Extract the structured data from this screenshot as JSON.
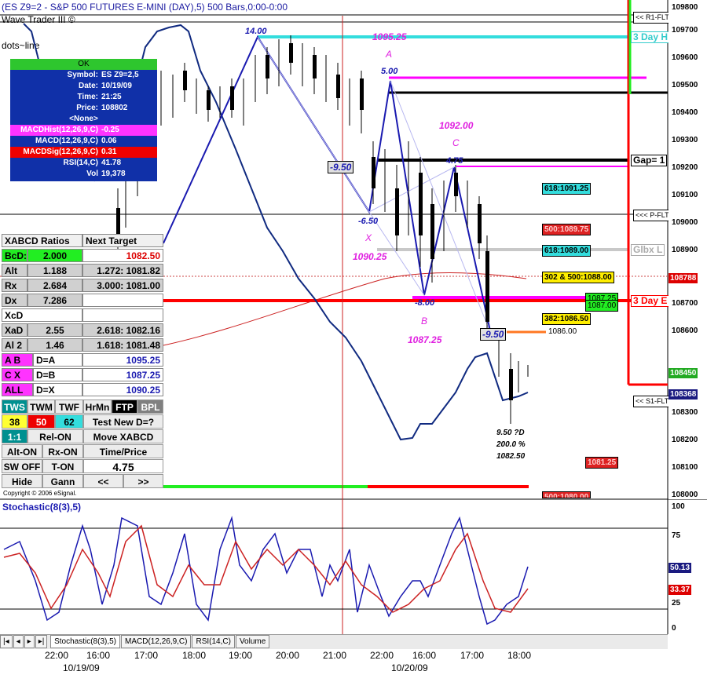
{
  "header": {
    "title": "(ES Z9=2 - S&P 500 FUTURES E-MINI (DAY),5) 500 Bars,0:00-0:00",
    "line2": "Wave Trader III ©",
    "line3": "dots~line"
  },
  "data_window": {
    "status": "OK",
    "rows": [
      {
        "label": "Symbol:",
        "value": "ES Z9=2,5"
      },
      {
        "label": "Date:",
        "value": "10/19/09"
      },
      {
        "label": "Time:",
        "value": "21:25"
      },
      {
        "label": "Price:",
        "value": "108802"
      }
    ],
    "none_label": "<None>",
    "indicators": [
      {
        "label": "MACDHist(12,26,9,C)",
        "value": "-0.25",
        "color": "#ff33ff"
      },
      {
        "label": "MACD(12,26,9,C)",
        "value": "0.06",
        "color": "#1030a8"
      },
      {
        "label": "MACDSig(12,26,9,C)",
        "value": "0.31",
        "color": "#ff0000"
      },
      {
        "label": "RSI(14,C)",
        "value": "41.78",
        "color": "#1030a8"
      },
      {
        "label": "Vol",
        "value": "19,378",
        "color": "#1030a8"
      }
    ]
  },
  "xabcd_panel": {
    "header_left": "XABCD Ratios",
    "header_right": "Next Target",
    "rows": [
      {
        "label": "BcD:",
        "value": "2.000",
        "target": "1082.50"
      },
      {
        "label": "Alt",
        "value": "1.188",
        "target": "1.272: 1081.82"
      },
      {
        "label": "Rx",
        "value": "2.684",
        "target": "3.000: 1081.00"
      },
      {
        "label": "Dx",
        "value": "7.286",
        "target": ""
      },
      {
        "label": "XcD",
        "value": "",
        "target": ""
      },
      {
        "label": "XaD",
        "value": "2.55",
        "target": "2.618: 1082.16"
      },
      {
        "label": "Al 2",
        "value": "1.46",
        "target": "1.618: 1081.48"
      },
      {
        "label": "A B",
        "value": "D=A",
        "target": "1095.25"
      },
      {
        "label": "C X",
        "value": "D=B",
        "target": "1087.25"
      },
      {
        "label": "ALL",
        "value": "D=X",
        "target": "1090.25"
      }
    ],
    "mode_tabs": [
      "TWS",
      "TWM",
      "TWF",
      "HrMn",
      "FTP",
      "BPL"
    ],
    "numbers": [
      "38",
      "50",
      "62"
    ],
    "buttons": {
      "test_new": "Test New D=?",
      "one_one": "1:1",
      "rel_on": "Rel-ON",
      "move_xabcd": "Move XABCD",
      "alt_on": "Alt-ON",
      "rx_on": "Rx-ON",
      "time_price": "Time/Price",
      "sw_off": "SW OFF",
      "t_on": "T-ON",
      "step_value": "4.75",
      "hide": "Hide",
      "gann": "Gann",
      "prev": "<<",
      "next": ">>"
    },
    "copyright": "Copyright © 2006 eSignal."
  },
  "pattern_labels": {
    "a_price": "1095.25",
    "a_letter": "A",
    "c_price": "1092.00",
    "c_letter": "C",
    "x_letter": "X",
    "x_price": "1090.25",
    "b_letter": "B",
    "b_price": "1087.25",
    "top_swing": "14.00",
    "a_swing": "5.00",
    "c_swing": "4.75",
    "neg950": "-9.50",
    "neg650": "-6.50",
    "neg800": "-8.00",
    "neg950b": "-9.50",
    "d_note1": "9.50 ?D",
    "d_note2": "200.0 %",
    "d_note3": "1082.50"
  },
  "chart_tags": {
    "r1": "<< R1-FLT",
    "day3_top": "3 Day H",
    "gap": "Gap= 1",
    "pfl": "<<< P-FLT",
    "glbx": "Glbx L",
    "day3_bot": "3 Day E",
    "s1": "<< S1-FLT",
    "fib618a": "618:1091.25",
    "fib500": "500:1089.75",
    "fib618b": "618:1089.00",
    "fib302": "302 & 500:1088.00",
    "fib382": "382:1086.50",
    "p1086": "1086.00",
    "p1087a": "1087.25",
    "p1087b": "1087.00",
    "p1081": "1081.25",
    "p1080": "500:1080.00"
  },
  "price_axis": {
    "labels": [
      "109800",
      "109700",
      "109600",
      "109500",
      "109400",
      "109300",
      "109200",
      "109100",
      "109000",
      "108900",
      "108800",
      "108700",
      "108600",
      "108500",
      "108400",
      "108300",
      "108200",
      "108100",
      "108000"
    ],
    "last_price": "108788",
    "price_green": "108450",
    "price_blue": "108368"
  },
  "stochastic": {
    "title": "Stochastic(8(3),5)",
    "axis": [
      "100",
      "75",
      "50",
      "25",
      "0"
    ],
    "value_blue": "50.13",
    "value_red": "33.37"
  },
  "bottom_tabs": [
    "Stochastic(8(3),5)",
    "MACD(12,26,9,C)",
    "RSI(14,C)",
    "Volume"
  ],
  "time_axis": {
    "labels": [
      "22:00",
      "16:00",
      "17:00",
      "18:00",
      "19:00",
      "20:00",
      "21:00",
      "22:00",
      "16:00",
      "17:00",
      "18:00"
    ],
    "dates": [
      "10/19/09",
      "10/20/09"
    ]
  },
  "colors": {
    "candle": "#000000",
    "pattern": "#1a1ab0",
    "magenta": "#ff00ff",
    "cyan": "#33dddd",
    "red_line": "#ff0000",
    "green": "#22ee22"
  }
}
